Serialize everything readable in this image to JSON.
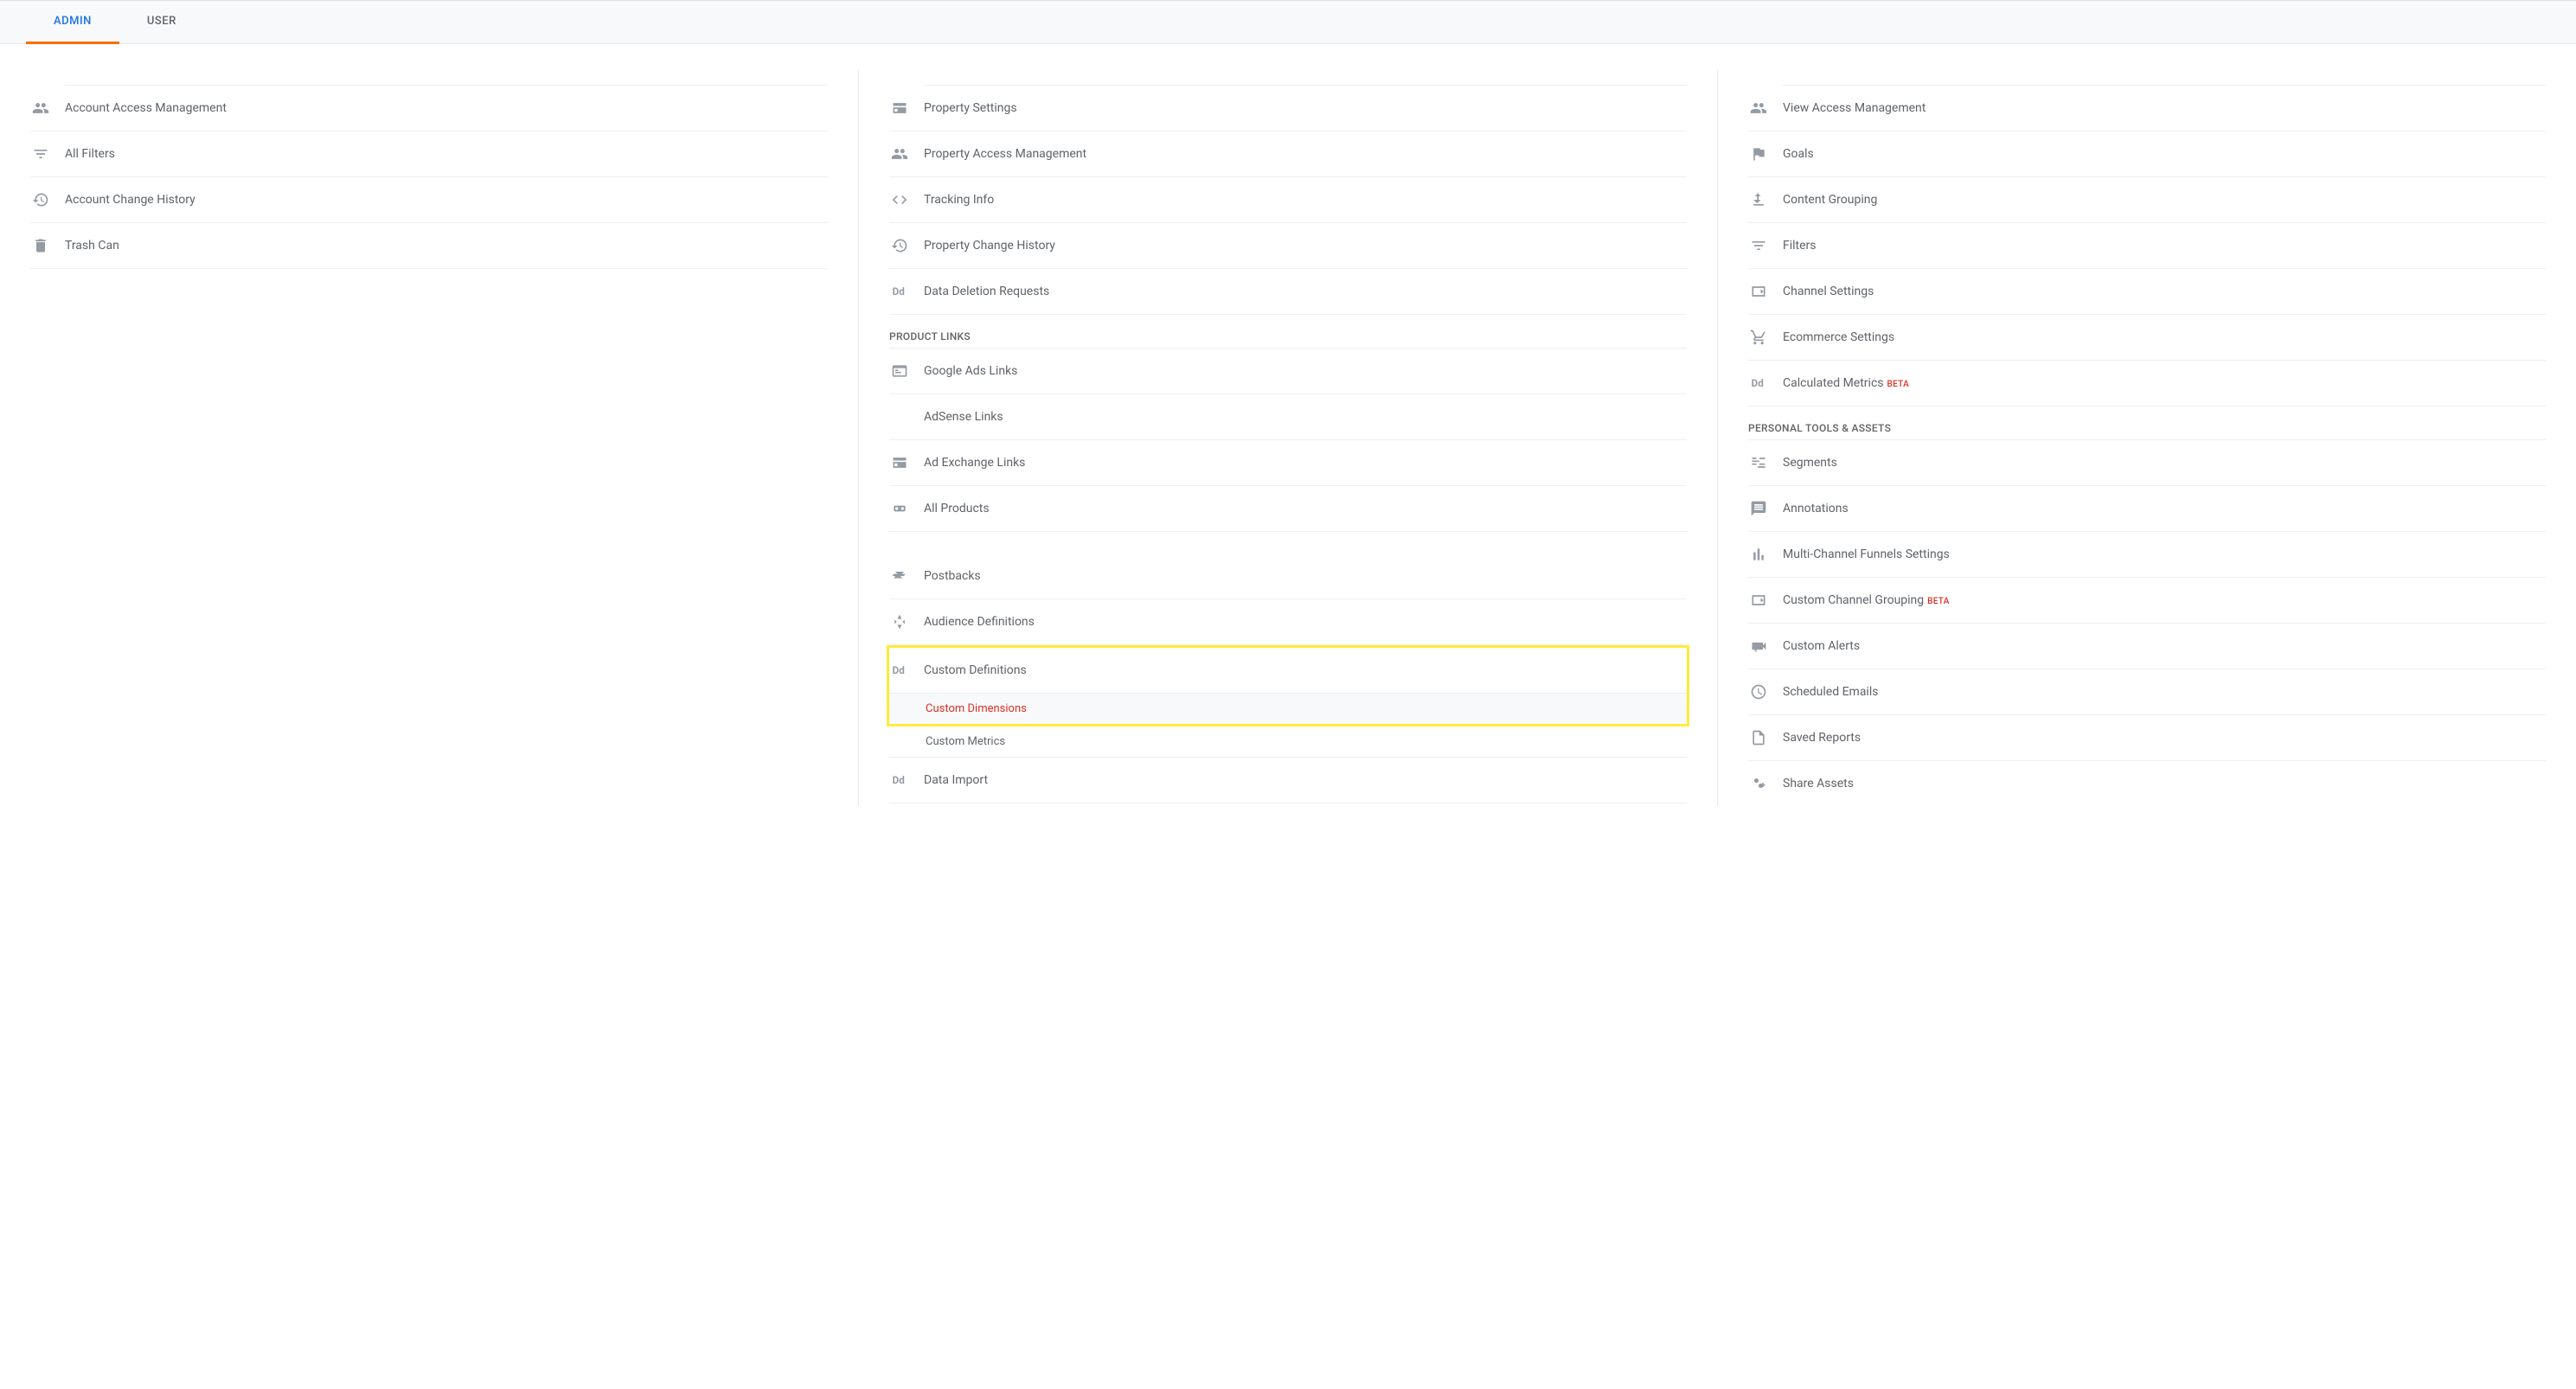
{
  "tabs": {
    "admin": "ADMIN",
    "user": "USER"
  },
  "column1": {
    "items": [
      {
        "label": "Account Access Management",
        "icon": "people"
      },
      {
        "label": "All Filters",
        "icon": "filter"
      },
      {
        "label": "Account Change History",
        "icon": "history"
      },
      {
        "label": "Trash Can",
        "icon": "trash"
      }
    ]
  },
  "column2": {
    "items1": [
      {
        "label": "Property Settings",
        "icon": "settings-panel"
      },
      {
        "label": "Property Access Management",
        "icon": "people"
      },
      {
        "label": "Tracking Info",
        "icon": "code"
      },
      {
        "label": "Property Change History",
        "icon": "history"
      },
      {
        "label": "Data Deletion Requests",
        "icon": "dd"
      }
    ],
    "section1": "PRODUCT LINKS",
    "items2": [
      {
        "label": "Google Ads Links",
        "icon": "card"
      },
      {
        "label": "AdSense Links",
        "icon": ""
      },
      {
        "label": "Ad Exchange Links",
        "icon": "settings-panel"
      },
      {
        "label": "All Products",
        "icon": "link"
      }
    ],
    "items3": [
      {
        "label": "Postbacks",
        "icon": "postback"
      },
      {
        "label": "Audience Definitions",
        "icon": "audience"
      }
    ],
    "customDefs": {
      "label": "Custom Definitions",
      "icon": "dd",
      "sub": [
        {
          "label": "Custom Dimensions",
          "active": true
        },
        {
          "label": "Custom Metrics",
          "active": false
        }
      ]
    },
    "items4": [
      {
        "label": "Data Import",
        "icon": "dd"
      }
    ]
  },
  "column3": {
    "items1": [
      {
        "label": "View Access Management",
        "icon": "people"
      },
      {
        "label": "Goals",
        "icon": "flag"
      },
      {
        "label": "Content Grouping",
        "icon": "content-group"
      },
      {
        "label": "Filters",
        "icon": "filter"
      },
      {
        "label": "Channel Settings",
        "icon": "channel"
      },
      {
        "label": "Ecommerce Settings",
        "icon": "cart"
      },
      {
        "label": "Calculated Metrics",
        "icon": "dd",
        "badge": "BETA"
      }
    ],
    "section1": "PERSONAL TOOLS & ASSETS",
    "items2": [
      {
        "label": "Segments",
        "icon": "segments"
      },
      {
        "label": "Annotations",
        "icon": "annotation"
      },
      {
        "label": "Multi-Channel Funnels Settings",
        "icon": "bars"
      },
      {
        "label": "Custom Channel Grouping",
        "icon": "channel",
        "badge": "BETA"
      },
      {
        "label": "Custom Alerts",
        "icon": "megaphone"
      },
      {
        "label": "Scheduled Emails",
        "icon": "clock"
      },
      {
        "label": "Saved Reports",
        "icon": "document"
      },
      {
        "label": "Share Assets",
        "icon": "share"
      }
    ]
  }
}
